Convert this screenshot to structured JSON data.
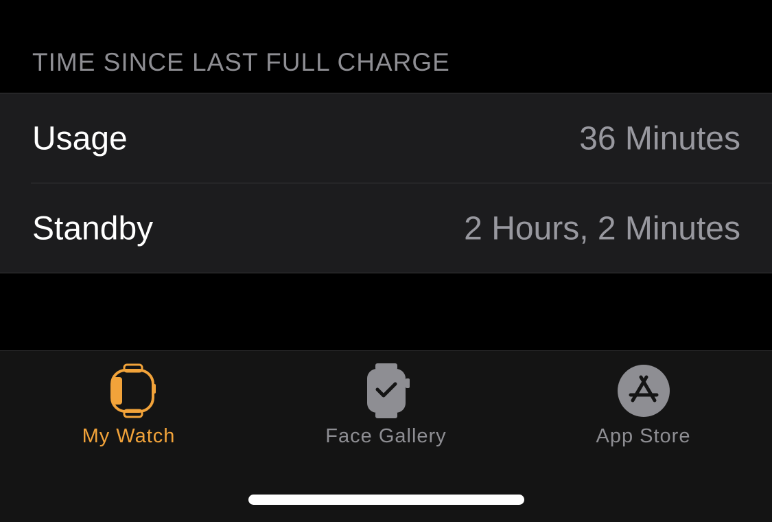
{
  "section": {
    "header": "TIME SINCE LAST FULL CHARGE"
  },
  "rows": [
    {
      "label": "Usage",
      "value": "36 Minutes"
    },
    {
      "label": "Standby",
      "value": "2 Hours, 2 Minutes"
    }
  ],
  "tabbar": {
    "tabs": [
      {
        "label": "My Watch",
        "icon": "watch-outline-icon",
        "active": true
      },
      {
        "label": "Face Gallery",
        "icon": "watch-face-icon",
        "active": false
      },
      {
        "label": "App Store",
        "icon": "app-store-icon",
        "active": false
      }
    ]
  },
  "colors": {
    "accent": "#f2a33a",
    "inactive": "#8e8e93",
    "background": "#000000",
    "cell_background": "#1c1c1e",
    "tabbar_background": "#141414"
  }
}
